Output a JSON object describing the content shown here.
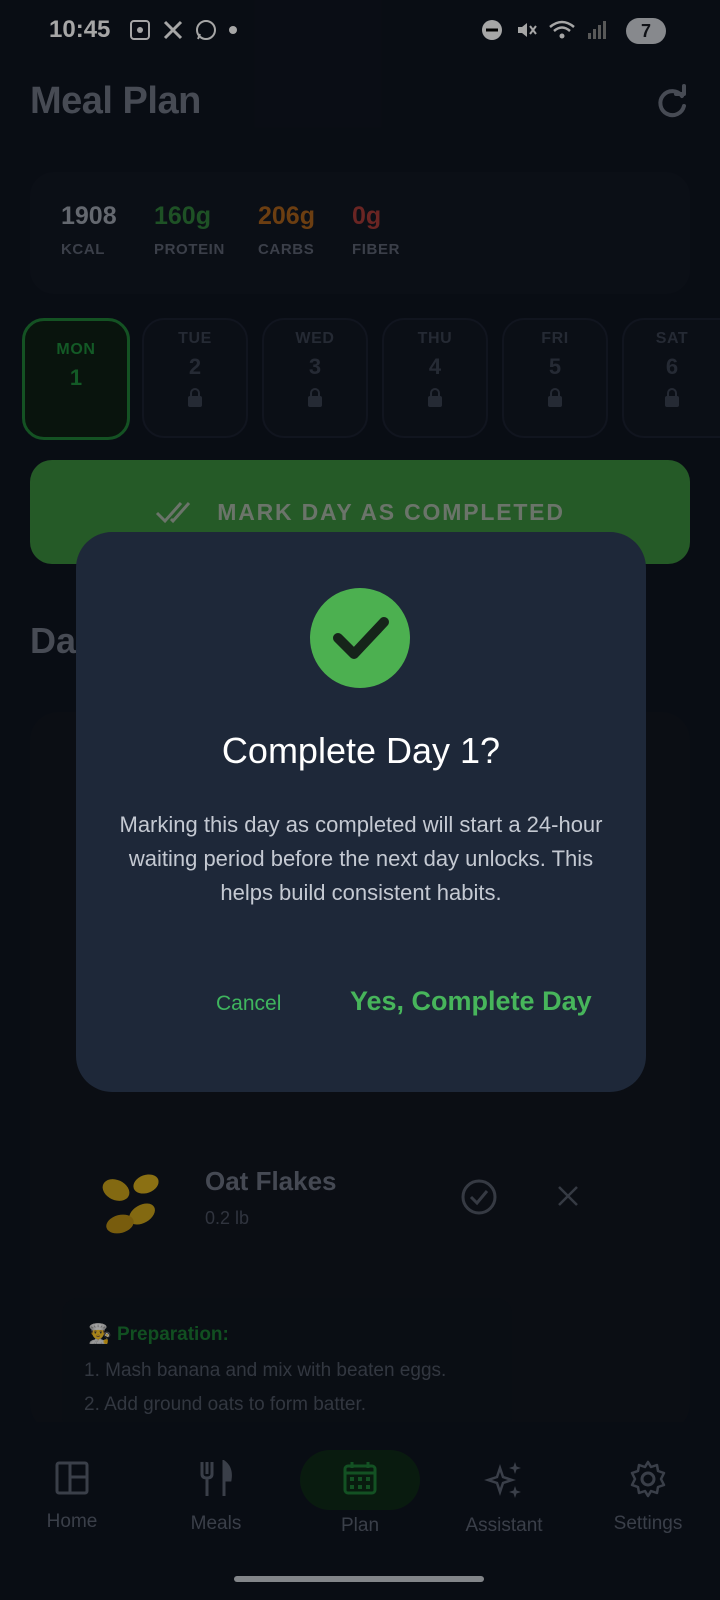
{
  "status": {
    "time": "10:45",
    "battery": "7"
  },
  "header": {
    "title": "Meal Plan"
  },
  "macros": [
    {
      "value": "1908",
      "label": "KCAL",
      "color": "#9aa0ab"
    },
    {
      "value": "160g",
      "label": "PROTEIN",
      "color": "#2e7d3a"
    },
    {
      "value": "206g",
      "label": "CARBS",
      "color": "#a6601b"
    },
    {
      "value": "0g",
      "label": "FIBER",
      "color": "#a33a36"
    }
  ],
  "days": [
    {
      "name": "MON",
      "num": "1",
      "locked": false
    },
    {
      "name": "TUE",
      "num": "2",
      "locked": true
    },
    {
      "name": "WED",
      "num": "3",
      "locked": true
    },
    {
      "name": "THU",
      "num": "4",
      "locked": true
    },
    {
      "name": "FRI",
      "num": "5",
      "locked": true
    },
    {
      "name": "SAT",
      "num": "6",
      "locked": true
    }
  ],
  "mark_button": "MARK DAY AS COMPLETED",
  "section_partial": "Da",
  "food": {
    "name": "Oat Flakes",
    "qty": "0.2 lb"
  },
  "preparation": {
    "title": "Preparation:",
    "steps": [
      "1. Mash banana and mix with beaten eggs.",
      "2. Add ground oats to form batter."
    ]
  },
  "dialog": {
    "title": "Complete Day 1?",
    "body": "Marking this day as completed will start a 24-hour waiting period before the next day unlocks. This helps build consistent habits.",
    "cancel": "Cancel",
    "confirm": "Yes, Complete Day"
  },
  "nav": [
    {
      "label": "Home",
      "icon": "dashboard-icon"
    },
    {
      "label": "Meals",
      "icon": "fork-knife-icon"
    },
    {
      "label": "Plan",
      "icon": "calendar-icon"
    },
    {
      "label": "Assistant",
      "icon": "sparkles-icon"
    },
    {
      "label": "Settings",
      "icon": "gear-icon"
    }
  ]
}
